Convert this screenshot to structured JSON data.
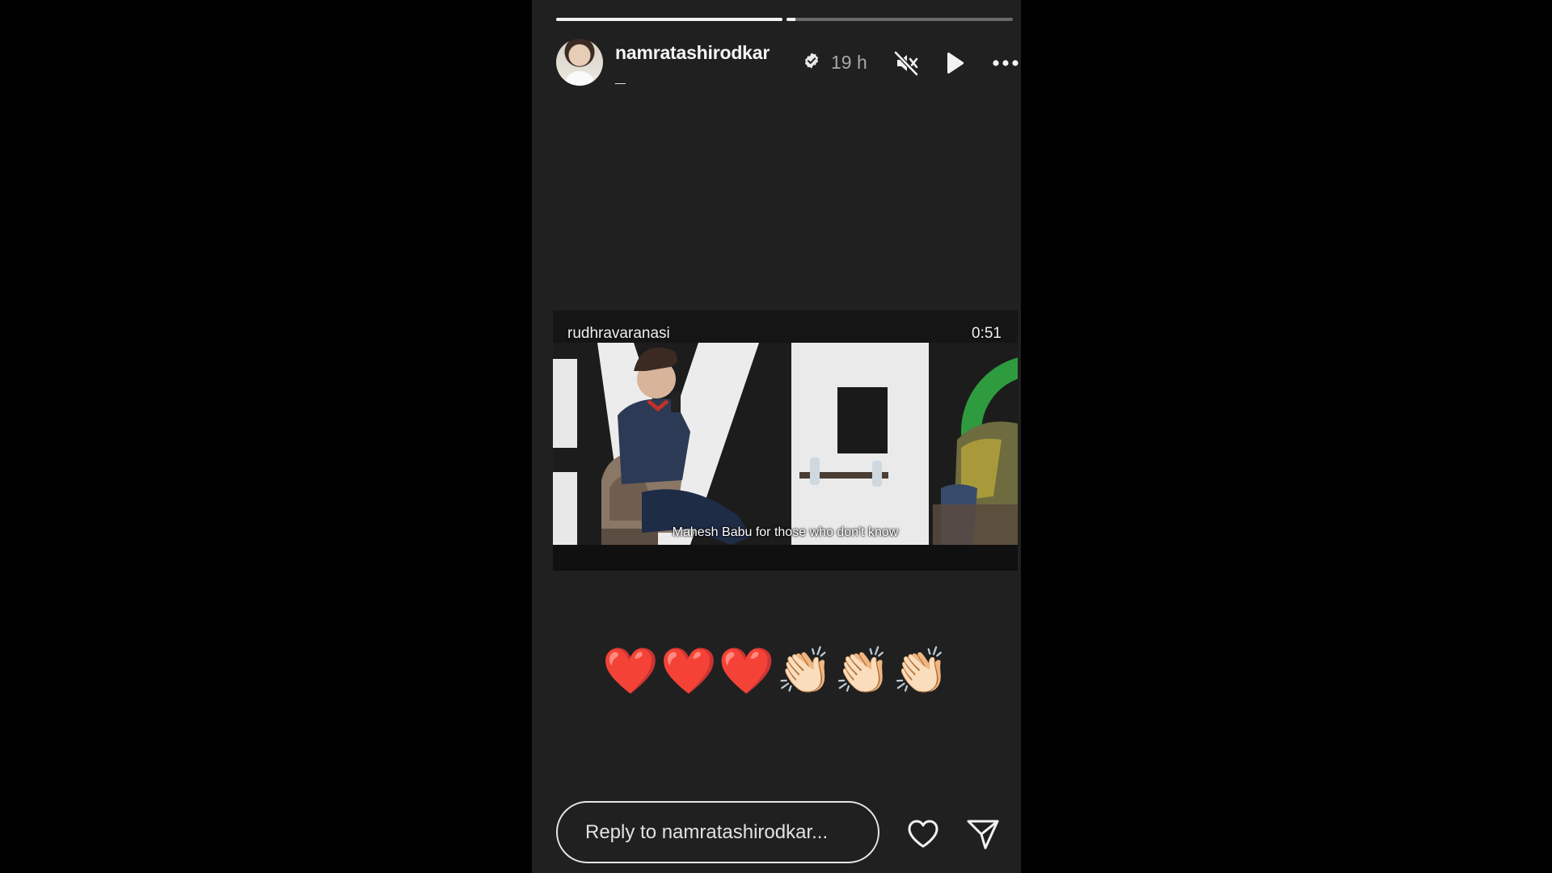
{
  "story": {
    "progress_segments": [
      {
        "label": "segment-1",
        "progress": 1.0
      },
      {
        "label": "segment-2",
        "progress": 0.04
      }
    ]
  },
  "header": {
    "username": "namratashirodkar_",
    "verified": true,
    "time": "19 h",
    "icons": {
      "mute": "muted-speaker-icon",
      "play": "play-icon",
      "more": "more-options-icon"
    }
  },
  "video": {
    "author": "rudhravaranasi",
    "duration": "0:51",
    "subtitle": "Mahesh Babu for those who don't know"
  },
  "reactions": "❤️❤️❤️👏🏻👏🏻👏🏻",
  "footer": {
    "reply_placeholder": "Reply to namratashirodkar...",
    "icons": {
      "like": "heart-icon",
      "share": "send-icon"
    }
  },
  "colors": {
    "background": "#000000",
    "story_background": "#202020",
    "progress_track": "#6a6a6a",
    "progress_fill": "#f2f2f2",
    "time_text": "#a8a8a8"
  }
}
